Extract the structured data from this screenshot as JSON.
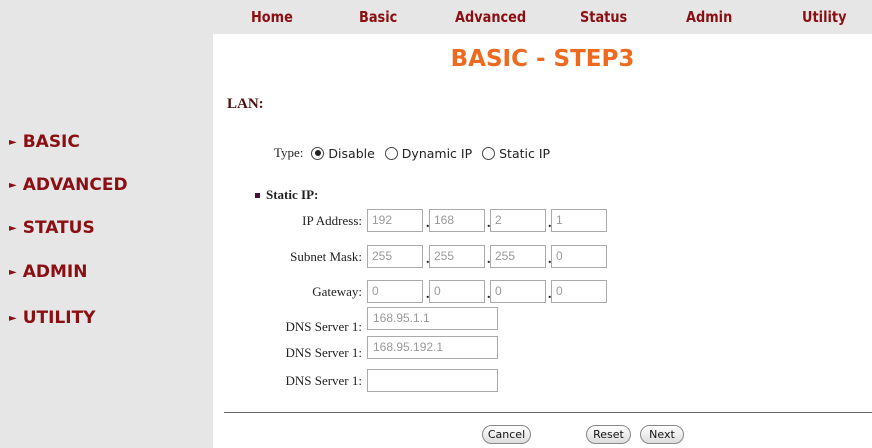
{
  "nav": {
    "items": [
      "Home",
      "Basic",
      "Advanced",
      "Status",
      "Admin",
      "Utility"
    ]
  },
  "sidebar": {
    "items": [
      "BASIC",
      "ADVANCED",
      "STATUS",
      "ADMIN",
      "UTILITY"
    ]
  },
  "page": {
    "title": "BASIC - STEP3"
  },
  "lan": {
    "section_label": "LAN:",
    "type_label": "Type:",
    "options": [
      "Disable",
      "Dynamic IP",
      "Static IP"
    ],
    "selected": "Disable",
    "static_header": "Static IP:",
    "ip_label": "IP Address:",
    "ip": [
      "192",
      "168",
      "2",
      "1"
    ],
    "subnet_label": "Subnet Mask:",
    "subnet": [
      "255",
      "255",
      "255",
      "0"
    ],
    "gateway_label": "Gateway:",
    "gateway": [
      "0",
      "0",
      "0",
      "0"
    ],
    "dns_labels": [
      "DNS Server 1:",
      "DNS Server 1:",
      "DNS Server 1:"
    ],
    "dns": [
      "168.95.1.1",
      "168.95.192.1",
      ""
    ]
  },
  "buttons": {
    "cancel": "Cancel",
    "reset": "Reset",
    "next": "Next"
  },
  "colors": {
    "brand": "#8b0f12",
    "title": "#ee6a20",
    "sidebar_bg": "#e6e6e6"
  }
}
